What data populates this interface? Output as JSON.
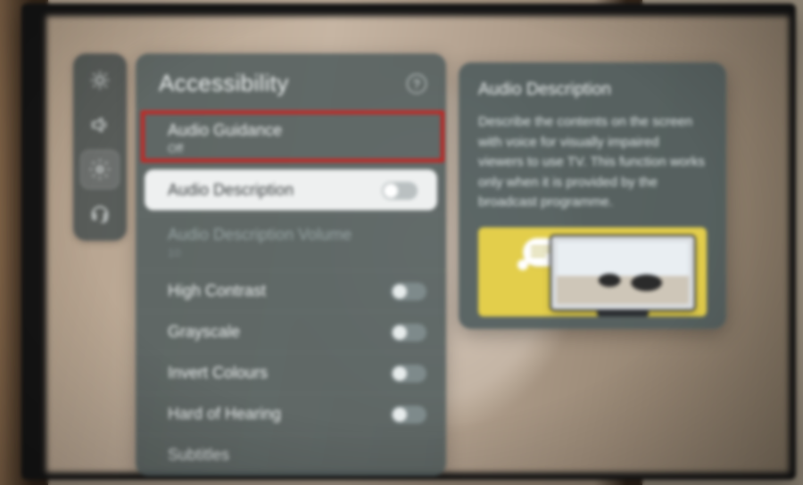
{
  "rail": {
    "items": [
      {
        "name": "brightness-icon"
      },
      {
        "name": "sound-icon"
      },
      {
        "name": "settings-icon"
      },
      {
        "name": "support-icon"
      }
    ],
    "active_index": 2
  },
  "panel": {
    "title": "Accessibility",
    "help_label": "?",
    "highlight_index": 0,
    "hover_index": 1,
    "items": [
      {
        "label": "Audio Guidance",
        "sub": "Off",
        "toggle": null,
        "dim": false
      },
      {
        "label": "Audio Description",
        "sub": "",
        "toggle": false,
        "dim": false
      },
      {
        "label": "Audio Description Volume",
        "sub": "10",
        "toggle": null,
        "dim": true
      },
      {
        "label": "High Contrast",
        "sub": "",
        "toggle": false,
        "dim": false
      },
      {
        "label": "Grayscale",
        "sub": "",
        "toggle": false,
        "dim": false
      },
      {
        "label": "Invert Colours",
        "sub": "",
        "toggle": false,
        "dim": false
      },
      {
        "label": "Hard of Hearing",
        "sub": "",
        "toggle": false,
        "dim": false
      },
      {
        "label": "Subtitles",
        "sub": "",
        "toggle": null,
        "dim": false
      }
    ]
  },
  "card": {
    "title": "Audio Description",
    "body": "Describe the contents on the screen with voice for visually impaired viewers to use TV. This function works only when it is provided by the broadcast programme."
  }
}
